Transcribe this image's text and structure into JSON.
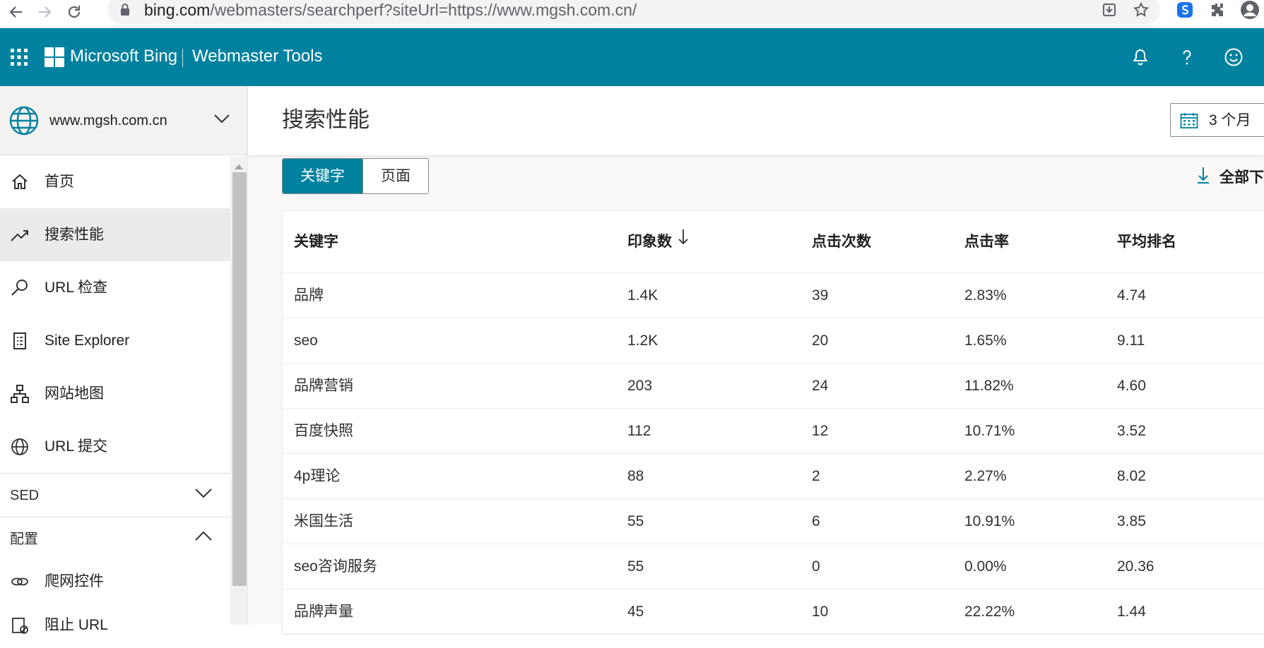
{
  "browser": {
    "url_host": "bing.com",
    "url_path": "/webmasters/searchperf?siteUrl=https://www.mgsh.com.cn/"
  },
  "header": {
    "brand": "Microsoft Bing",
    "product": "Webmaster Tools",
    "accent_color": "#00819f"
  },
  "sidebar": {
    "site": "www.mgsh.com.cn",
    "items": [
      {
        "label": "首页",
        "icon": "home-icon"
      },
      {
        "label": "搜索性能",
        "icon": "trend-icon",
        "active": true
      },
      {
        "label": "URL 检查",
        "icon": "search-icon"
      },
      {
        "label": "Site Explorer",
        "icon": "document-icon"
      },
      {
        "label": "网站地图",
        "icon": "sitemap-icon"
      },
      {
        "label": "URL 提交",
        "icon": "globe-icon"
      }
    ],
    "sections": [
      {
        "label": "SED",
        "expanded": false
      },
      {
        "label": "配置",
        "expanded": true
      }
    ],
    "sub_items": [
      {
        "label": "爬网控件",
        "icon": "crawl-icon"
      },
      {
        "label": "阻止 URL",
        "icon": "block-icon"
      }
    ]
  },
  "main": {
    "title": "搜索性能",
    "date_range": "3 个月",
    "tabs": [
      {
        "label": "关键字",
        "active": true
      },
      {
        "label": "页面",
        "active": false
      }
    ],
    "download_label": "全部下载",
    "table": {
      "columns": [
        "关键字",
        "印象数",
        "点击次数",
        "点击率",
        "平均排名"
      ],
      "rows": [
        [
          "品牌",
          "1.4K",
          "39",
          "2.83%",
          "4.74"
        ],
        [
          "seo",
          "1.2K",
          "20",
          "1.65%",
          "9.11"
        ],
        [
          "品牌营销",
          "203",
          "24",
          "11.82%",
          "4.60"
        ],
        [
          "百度快照",
          "112",
          "12",
          "10.71%",
          "3.52"
        ],
        [
          "4p理论",
          "88",
          "2",
          "2.27%",
          "8.02"
        ],
        [
          "米国生活",
          "55",
          "6",
          "10.91%",
          "3.85"
        ],
        [
          "seo咨询服务",
          "55",
          "0",
          "0.00%",
          "20.36"
        ],
        [
          "品牌声量",
          "45",
          "10",
          "22.22%",
          "1.44"
        ]
      ]
    }
  }
}
